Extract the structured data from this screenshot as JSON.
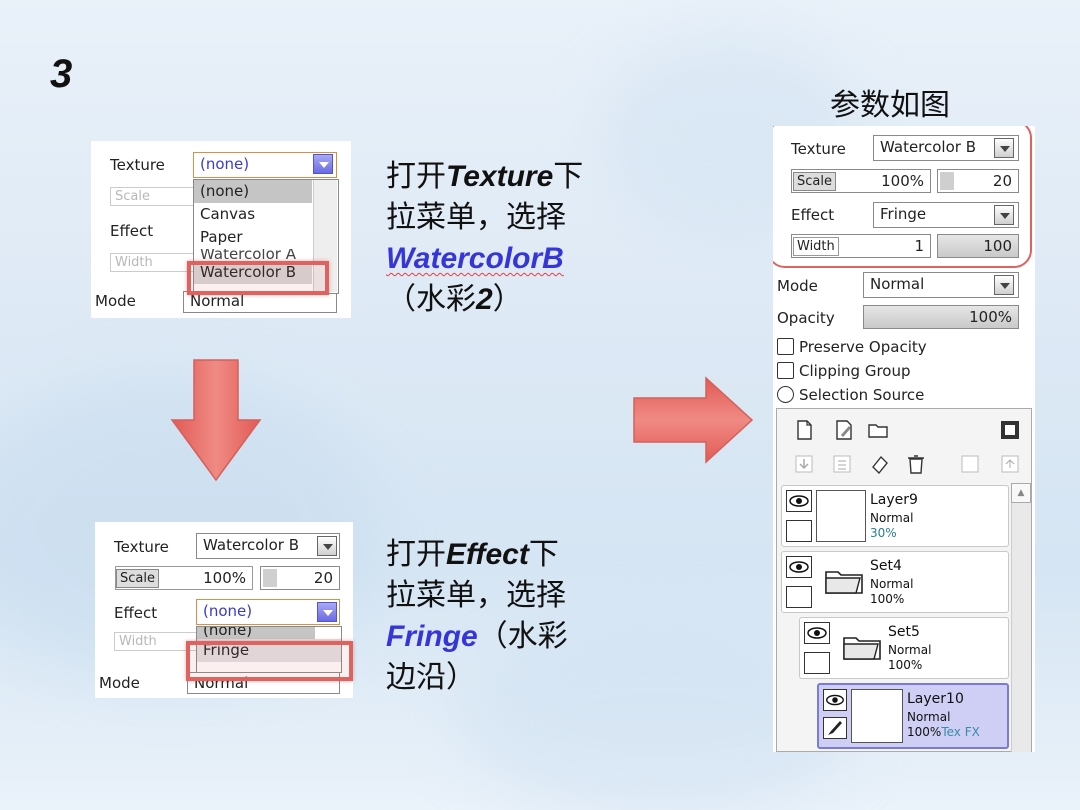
{
  "step_number": "3",
  "top_right_caption": "参数如图",
  "shot1": {
    "texture_label": "Texture",
    "texture_value": "(none)",
    "scale_label": "Scale",
    "effect_label": "Effect",
    "width_label": "Width",
    "mode_label": "Mode",
    "mode_value": "Normal",
    "options": [
      "(none)",
      "Canvas",
      "Paper",
      "Watercolor A",
      "Watercolor B"
    ]
  },
  "shot2": {
    "texture_label": "Texture",
    "texture_value": "Watercolor B",
    "scale_label": "Scale",
    "scale_value": "100%",
    "scale_amount": "20",
    "effect_label": "Effect",
    "effect_value": "(none)",
    "width_label": "Width",
    "mode_label": "Mode",
    "mode_value": "Normal",
    "options": [
      "(none)",
      "Fringe"
    ]
  },
  "text1": {
    "line1_pre": "打开",
    "line1_em": "Texture",
    "line1_post": "下",
    "line2": "拉菜单，选择",
    "line3_em": "WatercolorB",
    "line4": "（水彩",
    "line4_em": "2",
    "line4_post": "）"
  },
  "text2": {
    "line1_pre": "打开",
    "line1_em": "Effect",
    "line1_post": "下",
    "line2": "拉菜单，选择",
    "line3_em": "Fringe",
    "line3_post": "（水彩",
    "line4": "边沿）"
  },
  "panel": {
    "texture_label": "Texture",
    "texture_value": "Watercolor B",
    "scale_label": "Scale",
    "scale_value": "100%",
    "scale_amount": "20",
    "effect_label": "Effect",
    "effect_value": "Fringe",
    "width_label": "Width",
    "width_value": "1",
    "width_amount": "100",
    "mode_label": "Mode",
    "mode_value": "Normal",
    "opacity_label": "Opacity",
    "opacity_value": "100%",
    "preserve_opacity": "Preserve Opacity",
    "clipping_group": "Clipping Group",
    "selection_source": "Selection Source",
    "layers": [
      {
        "name": "Layer9",
        "mode": "Normal",
        "opacity": "30%"
      },
      {
        "name": "Set4",
        "mode": "Normal",
        "opacity": "100%"
      },
      {
        "name": "Set5",
        "mode": "Normal",
        "opacity": "100%"
      },
      {
        "name": "Layer10",
        "mode": "Normal",
        "opacity": "100%",
        "extra": "Tex FX"
      }
    ]
  },
  "colors": {
    "highlight": "#e0625e",
    "accent_blue": "#3535d8",
    "arrow": "#e8706a"
  },
  "icons": [
    "down-arrow-icon",
    "right-arrow-icon",
    "new-layer-icon",
    "new-linework-icon",
    "new-folder-icon",
    "mask-icon",
    "eye-icon",
    "folder-icon",
    "brush-icon",
    "trash-icon"
  ]
}
